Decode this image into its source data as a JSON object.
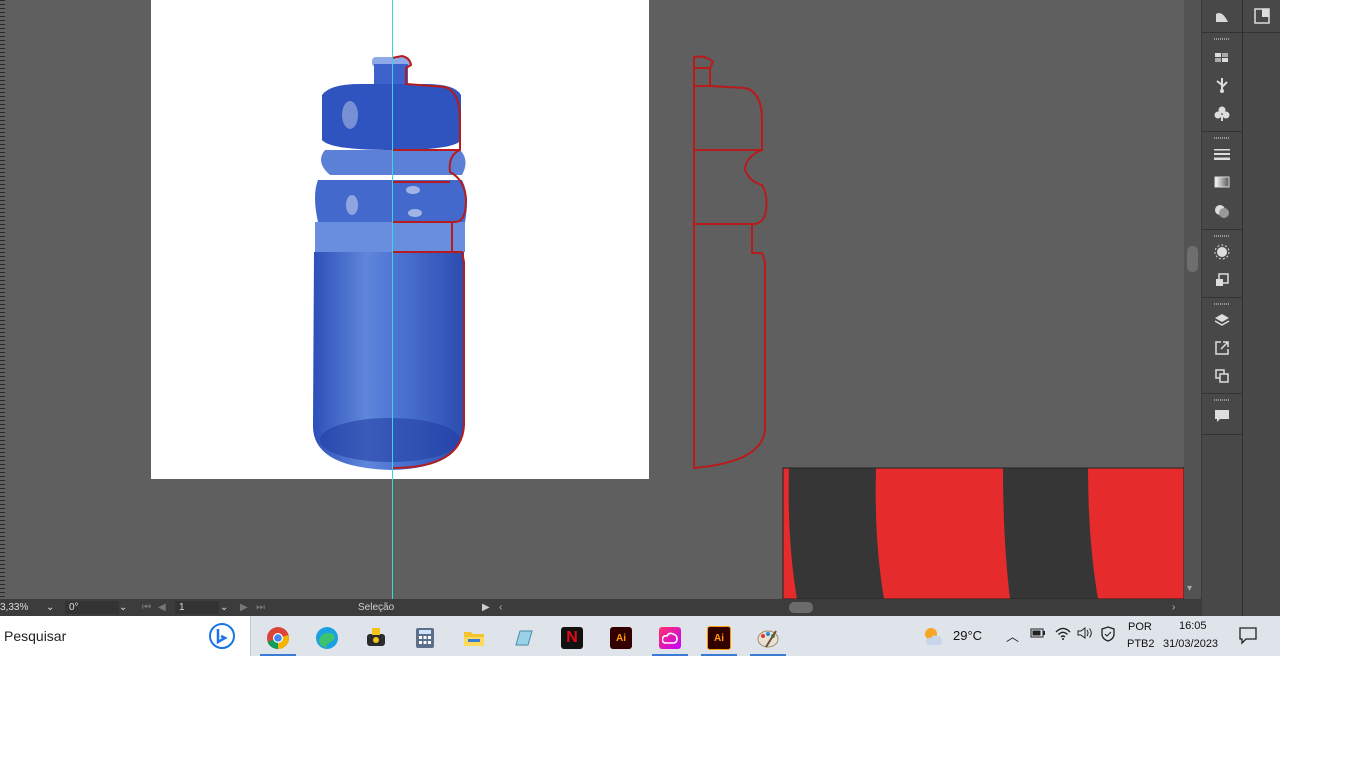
{
  "status_bar": {
    "zoom": "3,33%",
    "rotation": "0°",
    "artboard_number": "1",
    "current_tool": "Seleção"
  },
  "taskbar": {
    "search_label": "Pesquisar",
    "weather_temp": "29°C",
    "language_line1": "POR",
    "language_line2": "PTB2",
    "time": "16:05",
    "date": "31/03/2023",
    "apps": [
      "chrome",
      "edge",
      "gamer-app",
      "calculator",
      "file-explorer",
      "notepad",
      "netflix",
      "illustrator",
      "creative-cloud",
      "illustrator",
      "paint"
    ],
    "illustrator_label": "Ai"
  },
  "panels": {
    "icons": [
      "gradient-panel-icon",
      "swatches-icon",
      "symbols-icon",
      "clubs-icon",
      "stroke-icon",
      "gradient-icon",
      "transparency-icon",
      "appearance-icon",
      "graphic-styles-icon",
      "layers-icon",
      "export-icon",
      "artboards-icon",
      "comments-icon",
      "properties-icon"
    ]
  },
  "colors": {
    "canvas_bg": "#5f5f5f",
    "guide": "#35d6e6",
    "outline_red": "#b81b1b",
    "stripe_red": "#e52b2b",
    "stripe_dark": "#363636",
    "ai_orange": "#ff9a00"
  }
}
